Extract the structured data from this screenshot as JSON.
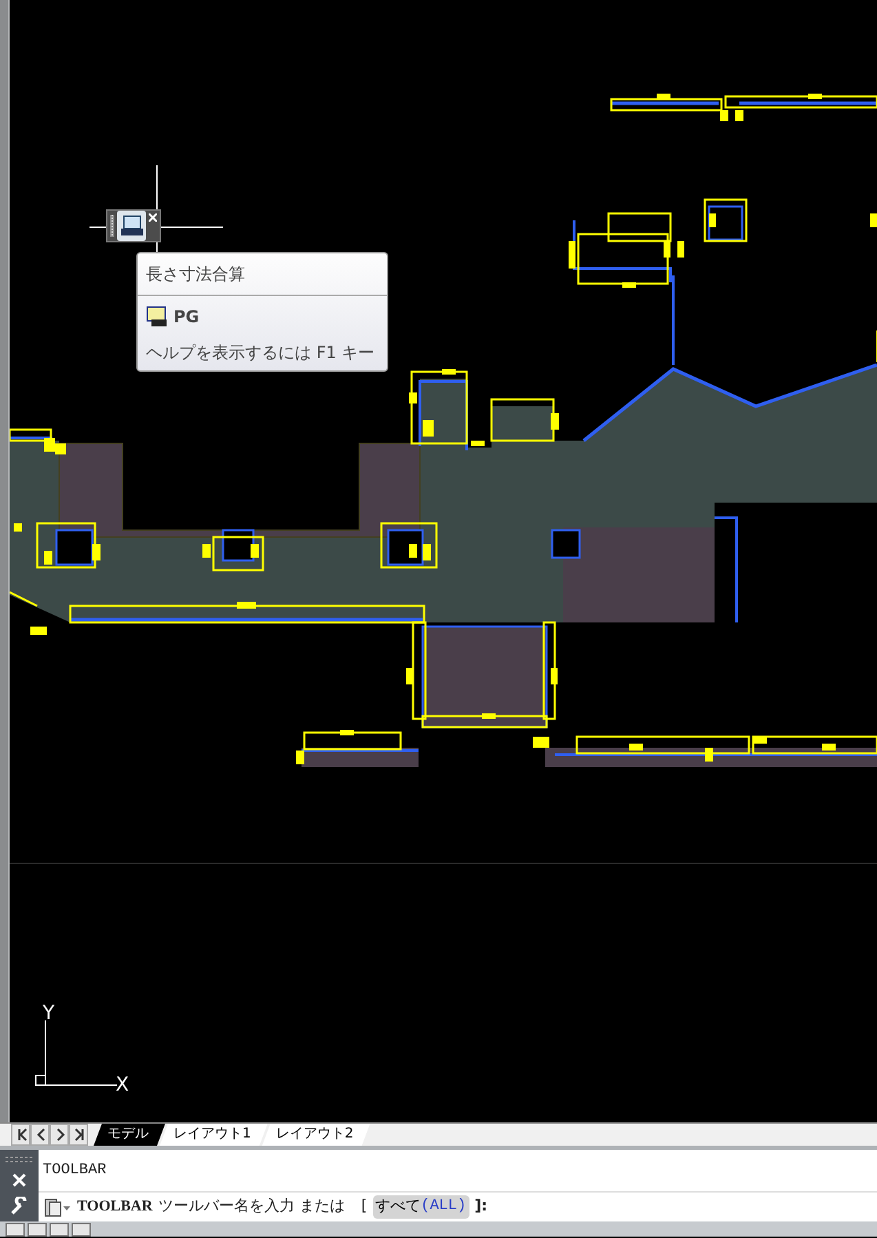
{
  "floating_toolbar": {
    "button_tooltip": {
      "title": "長さ寸法合算",
      "command": "PG",
      "help": "ヘルプを表示するには F1 キー"
    }
  },
  "ucs_icon": {
    "y_label": "Y",
    "x_label": "X"
  },
  "layout_tabs": [
    {
      "label": "モデル",
      "selected": true
    },
    {
      "label": "レイアウト1",
      "selected": false
    },
    {
      "label": "レイアウト2",
      "selected": false
    }
  ],
  "command_line": {
    "history": "TOOLBAR",
    "prompt": {
      "command": "TOOLBAR",
      "text": "ツールバー名を入力 または",
      "open": "[",
      "option_label": "すべて",
      "option_key": "(ALL)",
      "close": "]:"
    }
  }
}
